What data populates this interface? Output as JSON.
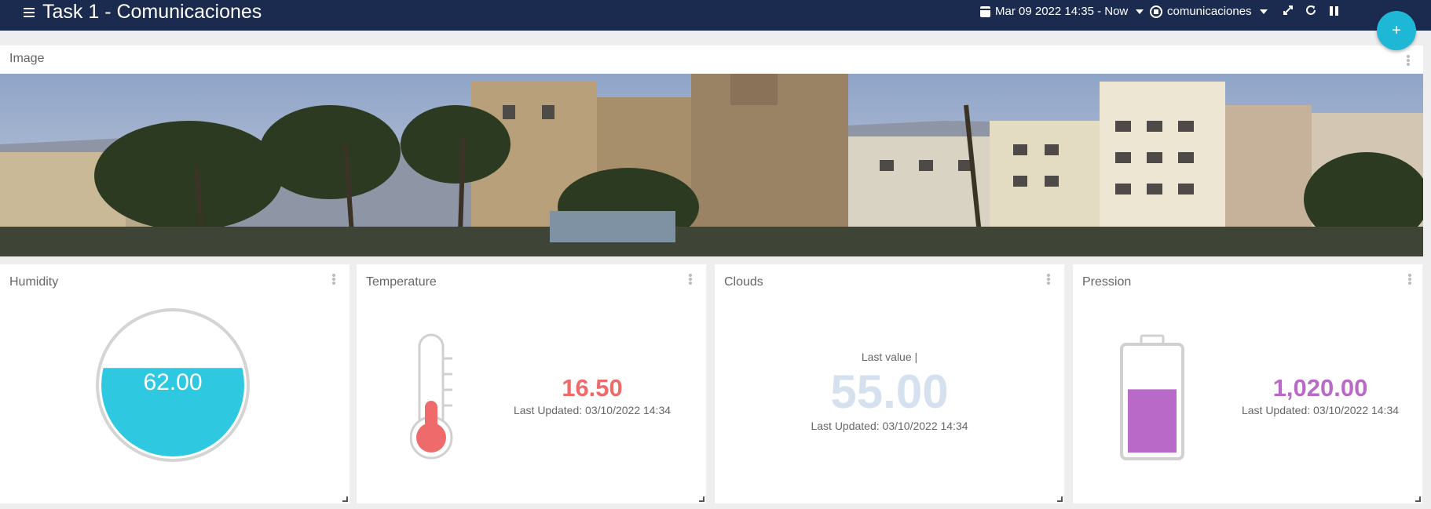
{
  "header": {
    "title": "Task 1 - Comunicaciones",
    "date_range": "Mar 09 2022 14:35 - Now",
    "device": "comunicaciones"
  },
  "fab_label": "+",
  "image_panel": {
    "title": "Image"
  },
  "widgets": {
    "humidity": {
      "title": "Humidity",
      "value": "62.00",
      "fill_fraction": 0.62
    },
    "temperature": {
      "title": "Temperature",
      "value": "16.50",
      "updated": "Last Updated: 03/10/2022 14:34"
    },
    "clouds": {
      "title": "Clouds",
      "caption": "Last value |",
      "value": "55.00",
      "updated": "Last Updated: 03/10/2022 14:34"
    },
    "pression": {
      "title": "Pression",
      "value": "1,020.00",
      "updated": "Last Updated: 03/10/2022 14:34"
    }
  },
  "colors": {
    "topbar": "#1b2b4f",
    "accent": "#1eb8d6",
    "humidity": "#2ec8e0",
    "temperature": "#ef6b6b",
    "clouds": "#d6e1ef",
    "pression": "#b96ac9"
  }
}
